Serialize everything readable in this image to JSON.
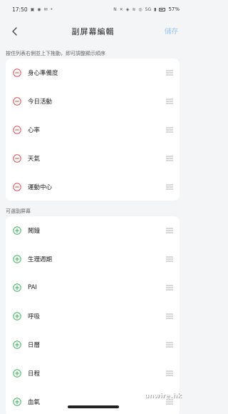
{
  "status_bar": {
    "time": "17:50",
    "left_icons": [
      "message-icon",
      "chat-icon",
      "mail-icon",
      "dot-icon"
    ],
    "right_icons": [
      "nfc-icon",
      "mute-icon",
      "location-icon",
      "wifi-icon",
      "hotspot-icon"
    ],
    "network": "5G",
    "battery": "57%"
  },
  "nav": {
    "title": "副屏幕編輯",
    "save_label": "儲存"
  },
  "sections": {
    "active_hint": "按住列表右側並上下拖動，即可調整顯示順序",
    "optional_title": "可選副屏幕"
  },
  "active_items": [
    {
      "label": "身心準備度"
    },
    {
      "label": "今日活動"
    },
    {
      "label": "心率"
    },
    {
      "label": "天氣"
    },
    {
      "label": "運動中心"
    }
  ],
  "optional_items": [
    {
      "label": "鬧鐘"
    },
    {
      "label": "生理週期"
    },
    {
      "label": "PAI"
    },
    {
      "label": "呼吸"
    },
    {
      "label": "日曆"
    },
    {
      "label": "日程"
    },
    {
      "label": "血氧"
    }
  ],
  "colors": {
    "remove": "#e64a4a",
    "add": "#35b955",
    "save_disabled": "#9dc8f0"
  },
  "watermark": "unwire.hk"
}
